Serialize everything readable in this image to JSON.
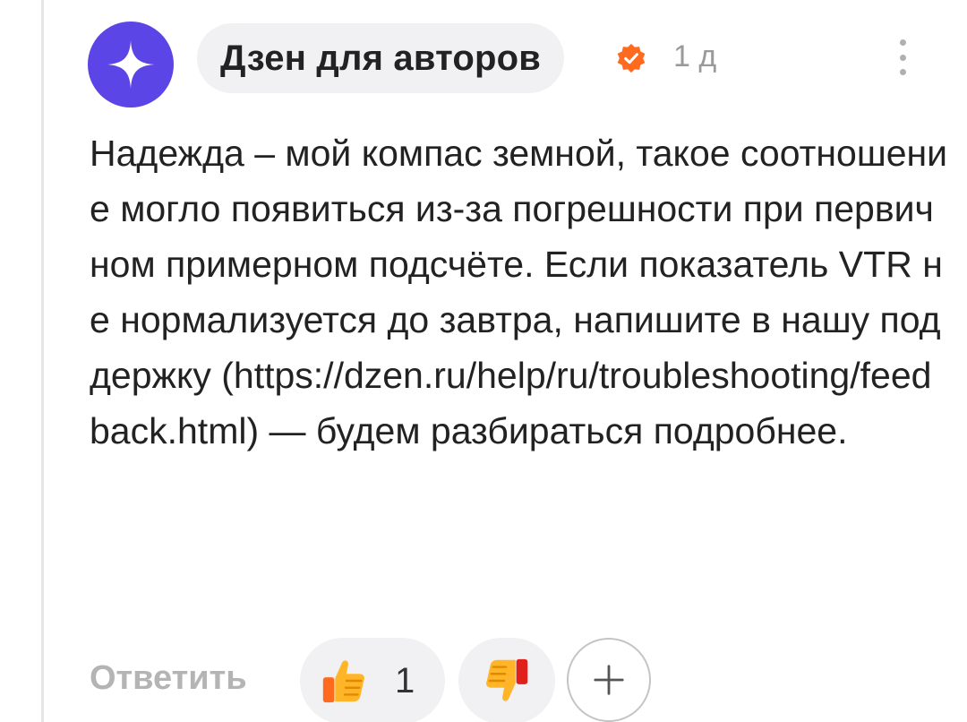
{
  "comment": {
    "author": "Дзен для авторов",
    "time": "1 д",
    "text": "Надежда – мой компас земной, такое соотношение могло появиться из-за погрешности при первичном примерном подсчёте. Если показатель VTR не нормализуется до завтра, напишите в нашу поддержку (https://dzen.ru/help/ru/troubleshooting/feedback.html) — будем разбираться подробнее.",
    "verified": true
  },
  "actions": {
    "reply_label": "Ответить",
    "like_count": "1"
  },
  "icons": {
    "avatar": "dzen-star-logo",
    "verified": "verified-check-icon",
    "more": "more-vertical-icon",
    "like": "thumbs-up-icon",
    "dislike": "thumbs-down-icon",
    "add": "plus-icon"
  },
  "colors": {
    "avatar_bg": "#5b45e6",
    "verified": "#ff6a1f",
    "pill_bg": "#f1f1f3"
  }
}
